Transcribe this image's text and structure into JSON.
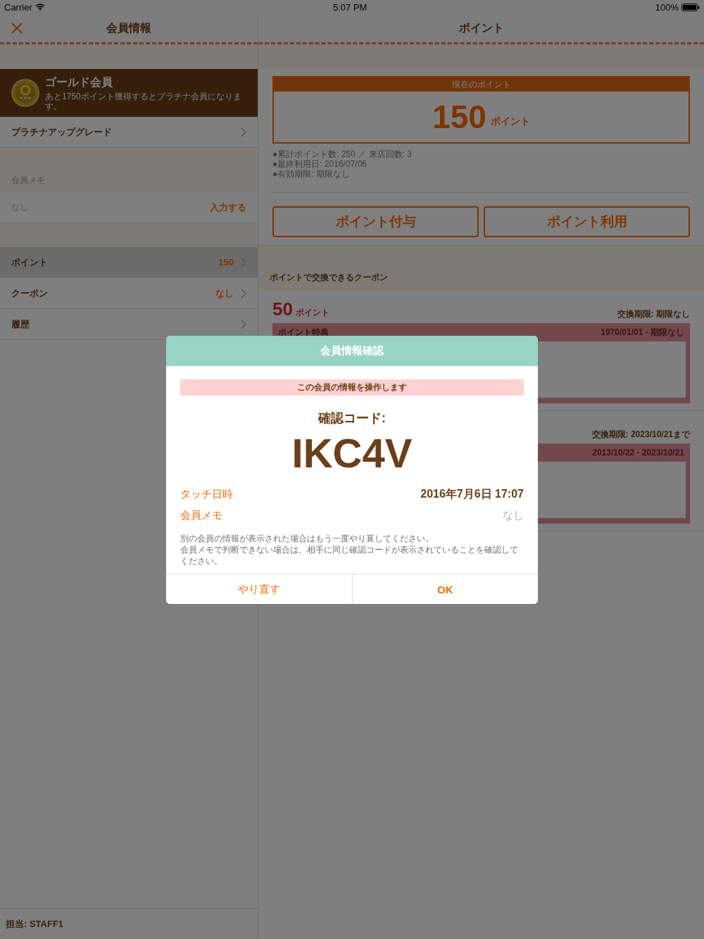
{
  "status_bar": {
    "carrier": "Carrier",
    "time": "5:07 PM",
    "battery": "100%"
  },
  "member_panel": {
    "title": "会員情報",
    "rank": {
      "title": "ゴールド会員",
      "subtitle": "あと1750ポイント獲得するとプラチナ会員になります。"
    },
    "upgrade": {
      "label": "プラチナアップグレード"
    },
    "memo": {
      "header": "会員メモ",
      "value": "なし",
      "action": "入力する"
    },
    "menu": [
      {
        "label": "ポイント",
        "value": "150",
        "selected": true
      },
      {
        "label": "クーポン",
        "value": "なし",
        "selected": false
      },
      {
        "label": "履歴",
        "selected": false
      }
    ],
    "staff": "担当: STAFF1"
  },
  "points_panel": {
    "title": "ポイント",
    "current": {
      "header": "現在のポイント",
      "value": "150",
      "unit": "ポイント"
    },
    "stats": [
      "●累計ポイント数: 250 ／ 来店回数: 3",
      "●最終利用日: 2016/07/06",
      "●有効期限: 期限なし"
    ],
    "buttons": [
      "ポイント付与",
      "ポイント利用"
    ],
    "coupons_header": "ポイントで交換できるクーポン",
    "coupons": [
      {
        "points": "50",
        "unit": "ポイント",
        "deadline": "交換期限: 期限なし",
        "category": "ポイント特典",
        "period": "1970/01/01 - 期限なし"
      },
      {
        "deadline": "交換期限: 2023/10/21まで",
        "period": "2013/10/22 - 2023/10/21"
      }
    ]
  },
  "dialog": {
    "title": "会員情報確認",
    "notice": "この会員の情報を操作します",
    "code_label": "確認コード:",
    "code": "IKC4V",
    "rows": [
      {
        "label": "タッチ日時",
        "value": "2016年7月6日 17:07",
        "empty": false
      },
      {
        "label": "会員メモ",
        "value": "なし",
        "empty": true
      }
    ],
    "note": [
      "別の会員の情報が表示された場合はもう一度やり直してください。",
      "会員メモで判断できない場合は、相手に同じ確認コードが表示されていることを確認してください。"
    ],
    "buttons": [
      {
        "label": "やり直す",
        "kind": "secondary"
      },
      {
        "label": "OK",
        "kind": "primary"
      }
    ]
  }
}
